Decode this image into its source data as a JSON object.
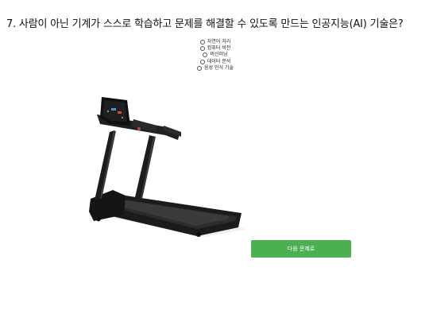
{
  "question": {
    "title": "7. 사람이 아닌 기계가 스스로 학습하고 문제를 해결할 수 있도록 만드는 인공지능(AI) 기술은?"
  },
  "options": [
    {
      "label": "자연어 처리",
      "selected": false
    },
    {
      "label": "컴퓨터 비전",
      "selected": false
    },
    {
      "label": "머신러닝",
      "selected": false
    },
    {
      "label": "데이터 분석",
      "selected": false
    },
    {
      "label": "음성 인식 기술",
      "selected": false
    }
  ],
  "image": {
    "subject": "treadmill"
  },
  "actions": {
    "next_label": "다음 문제로",
    "accent_color": "#4caf50"
  }
}
